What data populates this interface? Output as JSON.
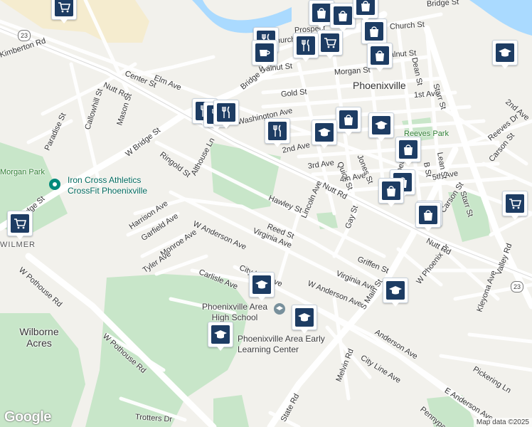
{
  "map": {
    "attribution": "Map data ©2025",
    "logo": "Google",
    "town_label": "Phoenixville",
    "street_labels": [
      "Kimberton Rd",
      "Center St",
      "Elm Ave",
      "Nutt Rd",
      "Callowhill St",
      "Mason St",
      "Paradise St",
      "W Bridge St",
      "Ringold St",
      "Althouse Ln",
      "Bridge St",
      "Washington Ave",
      "Gold St",
      "Church St",
      "Prospect",
      "Dean St",
      "Walnut St",
      "Morgan St",
      "1st Ave",
      "2nd Ave",
      "3rd Ave",
      "4th Ave",
      "Jones St",
      "Quick St",
      "5th Ave",
      "Lean St",
      "B St",
      "Starr St",
      "Starr St",
      "Reeves Dr",
      "Carson St",
      "2nd Ave",
      "Hawley St",
      "Lincoln Ave",
      "Gay St",
      "Reed St",
      "Virginia Ave",
      "Harrison Ave",
      "Garfield Ave",
      "Monroe Ave",
      "Tyler Ave",
      "W Anderson Ave",
      "Carlisle Ave",
      "City Line Ave",
      "Griffen St",
      "Virginia Ave",
      "W Anderson Ave",
      "S Main St",
      "W Phoenix Dr",
      "Kleyona Ave",
      "Valley Rd",
      "Anderson Ave",
      "City Line Ave",
      "Melvin Rd",
      "Pickering Ln",
      "E Anderson Ave",
      "Pennypack",
      "State Rd",
      "W Pothouse Rd",
      "W Pothouse Rd",
      "Trotters Dr",
      "Main St",
      "Nutt Rd",
      "Carson St",
      "Dean St",
      "Nutt Rd",
      "Walnut St",
      "Church St",
      "Ridge St",
      "Bridge St"
    ],
    "place_labels": [
      "Wilmer",
      "Wilborne Acres",
      "Reeves Park",
      "Morgan Park"
    ],
    "poi_labels": [
      "Iron Cross Athletics CrossFit Phoenixville",
      "Phoenixville Area High School",
      "Phoenixville Area Early Learning Center"
    ],
    "route_shields": [
      "23",
      "23"
    ],
    "markers": [
      {
        "type": "grocery",
        "name": "grocery-marker"
      },
      {
        "type": "grocery",
        "name": "grocery-marker"
      },
      {
        "type": "grocery",
        "name": "grocery-marker"
      },
      {
        "type": "grocery",
        "name": "grocery-marker"
      },
      {
        "type": "grocery",
        "name": "grocery-marker"
      },
      {
        "type": "shopping",
        "name": "shopping-marker"
      },
      {
        "type": "shopping",
        "name": "shopping-marker"
      },
      {
        "type": "shopping",
        "name": "shopping-marker"
      },
      {
        "type": "shopping",
        "name": "shopping-marker"
      },
      {
        "type": "shopping",
        "name": "shopping-marker"
      },
      {
        "type": "shopping",
        "name": "shopping-marker"
      },
      {
        "type": "shopping",
        "name": "shopping-marker"
      },
      {
        "type": "shopping",
        "name": "shopping-marker"
      },
      {
        "type": "shopping",
        "name": "shopping-marker"
      },
      {
        "type": "shopping",
        "name": "shopping-marker"
      },
      {
        "type": "restaurant",
        "name": "restaurant-marker"
      },
      {
        "type": "restaurant",
        "name": "restaurant-marker"
      },
      {
        "type": "restaurant",
        "name": "restaurant-marker"
      },
      {
        "type": "restaurant",
        "name": "restaurant-marker"
      },
      {
        "type": "restaurant",
        "name": "restaurant-marker"
      },
      {
        "type": "restaurant",
        "name": "restaurant-marker"
      },
      {
        "type": "cafe",
        "name": "cafe-marker"
      },
      {
        "type": "school",
        "name": "school-marker"
      },
      {
        "type": "school",
        "name": "school-marker"
      },
      {
        "type": "school",
        "name": "school-marker"
      },
      {
        "type": "school",
        "name": "school-marker"
      },
      {
        "type": "school",
        "name": "school-marker"
      },
      {
        "type": "school",
        "name": "school-marker"
      },
      {
        "type": "school",
        "name": "school-marker"
      }
    ],
    "colors": {
      "marker_fill": "#1d3c63",
      "park": "#c8e6c9",
      "water": "#aadaff",
      "major_road": "#ffffff",
      "background": "#f2f1ec"
    }
  }
}
